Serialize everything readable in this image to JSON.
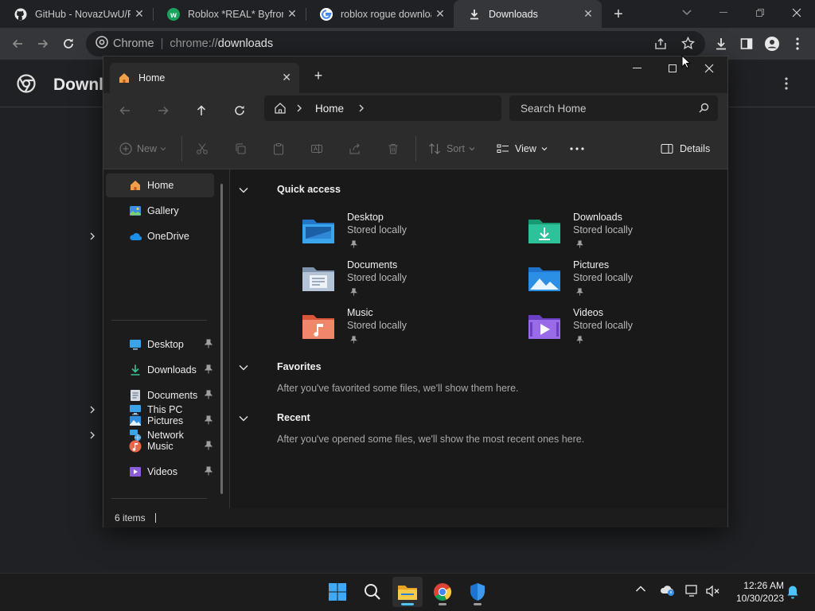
{
  "browser": {
    "tabs": [
      {
        "title": "GitHub - NovazUwU/Ro",
        "icon": "github-icon"
      },
      {
        "title": "Roblox *REAL* Byfron B",
        "icon": "wearedevs-icon"
      },
      {
        "title": "roblox rogue downloads",
        "icon": "google-icon"
      },
      {
        "title": "Downloads",
        "icon": "download-icon",
        "active": true
      }
    ],
    "omnibox": {
      "label": "Chrome",
      "separator": "|",
      "scheme": "chrome://",
      "host": "downloads"
    },
    "page_title": "Downloads"
  },
  "explorer": {
    "tab_title": "Home",
    "breadcrumb": [
      "Home"
    ],
    "search_placeholder": "Search Home",
    "commands": {
      "new": "New",
      "sort": "Sort",
      "view": "View",
      "details": "Details"
    },
    "nav": {
      "top": [
        {
          "label": "Home",
          "selected": true
        },
        {
          "label": "Gallery"
        },
        {
          "label": "OneDrive",
          "expandable": true
        }
      ],
      "pinned": [
        "Desktop",
        "Downloads",
        "Documents",
        "Pictures",
        "Music",
        "Videos"
      ],
      "bottom": [
        {
          "label": "This PC",
          "expandable": true
        },
        {
          "label": "Network",
          "expandable": true
        }
      ]
    },
    "quick_access": {
      "heading": "Quick access",
      "items": [
        {
          "name": "Desktop",
          "status": "Stored locally"
        },
        {
          "name": "Downloads",
          "status": "Stored locally"
        },
        {
          "name": "Documents",
          "status": "Stored locally"
        },
        {
          "name": "Pictures",
          "status": "Stored locally"
        },
        {
          "name": "Music",
          "status": "Stored locally"
        },
        {
          "name": "Videos",
          "status": "Stored locally"
        }
      ]
    },
    "favorites": {
      "heading": "Favorites",
      "message": "After you've favorited some files, we'll show them here."
    },
    "recent": {
      "heading": "Recent",
      "message": "After you've opened some files, we'll show the most recent ones here."
    },
    "status": "6 items"
  },
  "taskbar": {
    "time": "12:26 AM",
    "date": "10/30/2023"
  },
  "colors": {
    "accent": "#4cc2ff",
    "chrome_dark": "#202124",
    "explorer_bg": "#191919"
  }
}
